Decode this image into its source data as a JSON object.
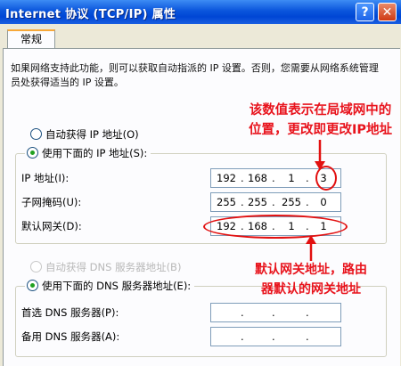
{
  "window": {
    "title": "Internet 协议 (TCP/IP) 属性",
    "help_label": "?",
    "close_label": "✕"
  },
  "tabs": [
    {
      "label": "常规",
      "selected": true
    }
  ],
  "description": "如果网络支持此功能，则可以获取自动指派的 IP 设置。否则，您需要从网络系统管理员处获得适当的 IP 设置。",
  "ip_section": {
    "auto_option": {
      "label": "自动获得 IP 地址(O)",
      "selected": false
    },
    "manual_option": {
      "label": "使用下面的 IP 地址(S):",
      "selected": true
    },
    "fields": [
      {
        "label": "IP 地址(I):",
        "octets": [
          "192",
          "168",
          "1",
          "3"
        ]
      },
      {
        "label": "子网掩码(U):",
        "octets": [
          "255",
          "255",
          "255",
          "0"
        ]
      },
      {
        "label": "默认网关(D):",
        "octets": [
          "192",
          "168",
          "1",
          "1"
        ]
      }
    ]
  },
  "dns_section": {
    "auto_option": {
      "label": "自动获得 DNS 服务器地址(B)",
      "selected": false,
      "disabled": true
    },
    "manual_option": {
      "label": "使用下面的 DNS 服务器地址(E):",
      "selected": true
    },
    "fields": [
      {
        "label": "首选 DNS 服务器(P):",
        "octets": [
          "",
          "",
          "",
          ""
        ]
      },
      {
        "label": "备用 DNS 服务器(A):",
        "octets": [
          "",
          "",
          "",
          ""
        ]
      }
    ]
  },
  "annotations": {
    "ip_note": [
      "该数值表示在局域网中的",
      "位置，更改即更改IP地址"
    ],
    "gateway_note": [
      "默认网关地址，路由",
      "器默认的网关地址"
    ],
    "color": "#e8131c"
  }
}
